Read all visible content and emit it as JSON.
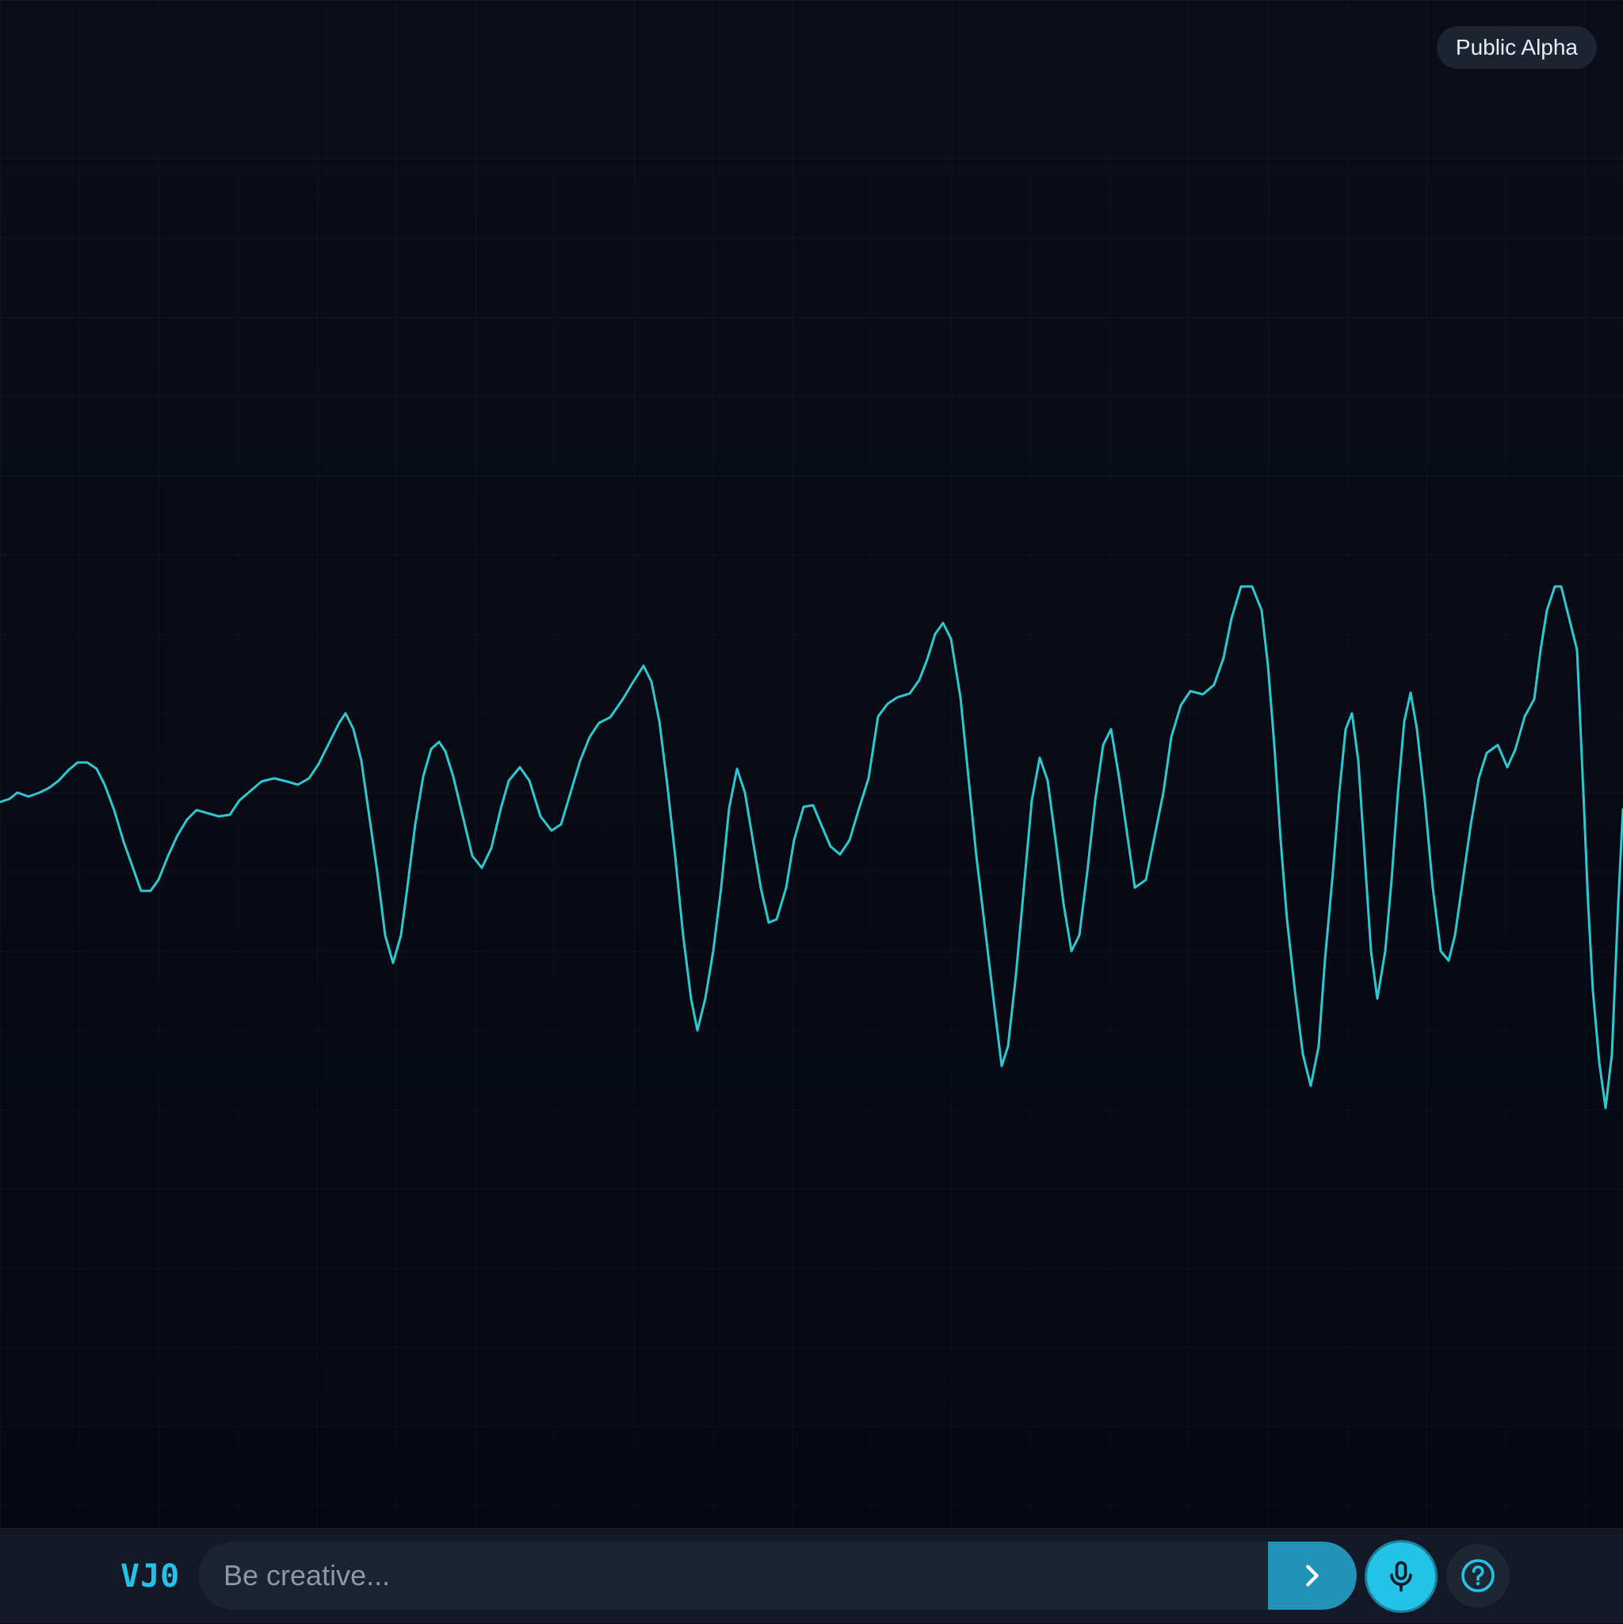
{
  "header": {
    "badge_label": "Public Alpha"
  },
  "visualizer": {
    "wave_color": "#2cc9d0",
    "background_color": "#090b14"
  },
  "bottom_bar": {
    "logo_text": "VJ0",
    "prompt": {
      "value": "",
      "placeholder": "Be creative..."
    },
    "send_icon": "chevron-right-icon",
    "mic_icon": "microphone-icon",
    "help_icon": "question-circle-icon"
  },
  "colors": {
    "accent": "#22c3e6",
    "send_button": "#2293b6",
    "bar_background": "#121826"
  }
}
